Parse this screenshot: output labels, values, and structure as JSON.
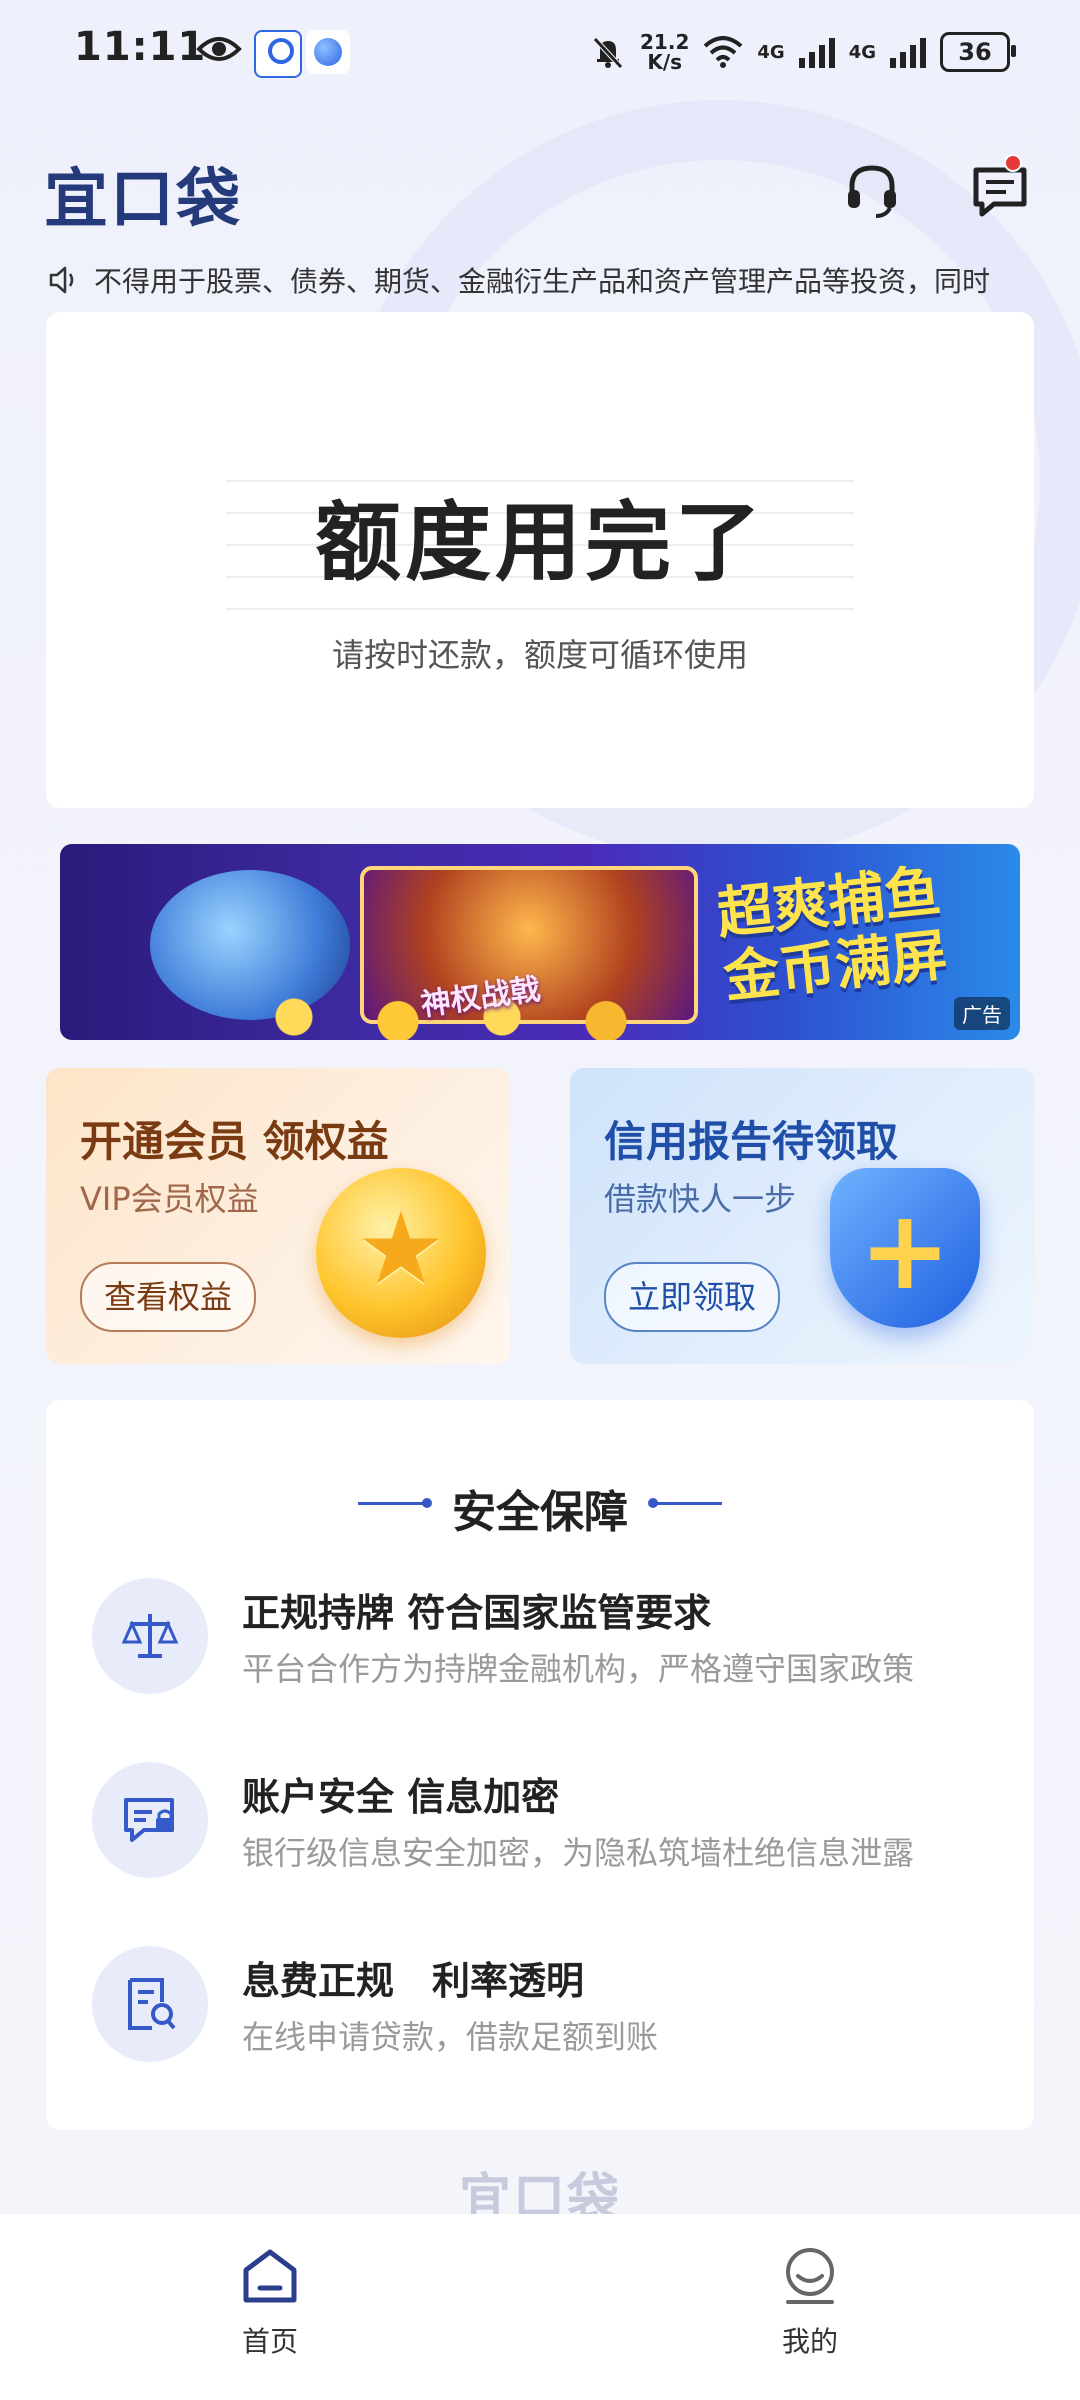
{
  "status_bar": {
    "time": "11:11",
    "net_speed_value": "21.2",
    "net_speed_unit": "K/s",
    "network1": "4G",
    "network2": "4G",
    "battery": "36"
  },
  "header": {
    "logo": "宜口袋"
  },
  "notice": {
    "text": "不得用于股票、债券、期货、金融衍生产品和资产管理产品等投资，同时"
  },
  "quota": {
    "title": "额度用完了",
    "subtitle": "请按时还款，额度可循环使用"
  },
  "ad": {
    "game_label": "神权战戟",
    "headline": "超爽捕鱼 金币满屏",
    "tag": "广告"
  },
  "promo": {
    "vip": {
      "title": "开通会员 领权益",
      "subtitle": "VIP会员权益",
      "button": "查看权益"
    },
    "credit": {
      "title": "信用报告待领取",
      "subtitle": "借款快人一步",
      "button": "立即领取"
    }
  },
  "security": {
    "title": "安全保障",
    "items": [
      {
        "title": "正规持牌 符合国家监管要求",
        "desc": "平台合作方为持牌金融机构，严格遵守国家政策"
      },
      {
        "title": "账户安全 信息加密",
        "desc": "银行级信息安全加密，为隐私筑墙杜绝信息泄露"
      },
      {
        "title": "息费正规　利率透明",
        "desc": "在线申请贷款，借款足额到账"
      }
    ]
  },
  "footer": {
    "logo": "宜口袋"
  },
  "nav": {
    "home": "首页",
    "mine": "我的"
  },
  "colors": {
    "accent": "#3559c8",
    "logo": "#253a7a",
    "badge": "#e53935"
  }
}
